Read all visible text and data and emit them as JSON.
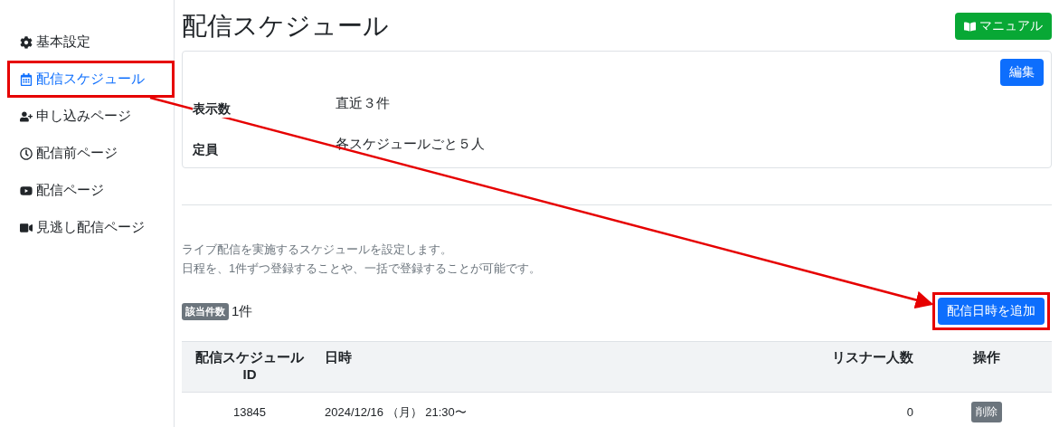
{
  "sidebar": {
    "items": [
      {
        "label": "基本設定",
        "selected": false,
        "highlighted": false
      },
      {
        "label": "配信スケジュール",
        "selected": true,
        "highlighted": true
      },
      {
        "label": "申し込みページ",
        "selected": false,
        "highlighted": false
      },
      {
        "label": "配信前ページ",
        "selected": false,
        "highlighted": false
      },
      {
        "label": "配信ページ",
        "selected": false,
        "highlighted": false
      },
      {
        "label": "見逃し配信ページ",
        "selected": false,
        "highlighted": false
      }
    ]
  },
  "page_title": "配信スケジュール",
  "manual_button": "マニュアル",
  "settings_card": {
    "edit_button": "編集",
    "rows": [
      {
        "label": "表示数",
        "value": "直近３件"
      },
      {
        "label": "定員",
        "value": "各スケジュールごと５人"
      }
    ]
  },
  "description": [
    "ライブ配信を実施するスケジュールを設定します。",
    "日程を、1件ずつ登録することや、一括で登録することが可能です。"
  ],
  "count": {
    "badge": "該当件数",
    "value": "1件"
  },
  "add_button": {
    "label": "配信日時を追加",
    "highlighted": true
  },
  "table": {
    "columns": [
      "配信スケジュール ID",
      "日時",
      "リスナー人数",
      "操作"
    ],
    "rows": [
      {
        "id": "13845",
        "datetime": "2024/12/16 （月） 21:30〜",
        "listeners": "0",
        "action": "削除"
      }
    ]
  }
}
